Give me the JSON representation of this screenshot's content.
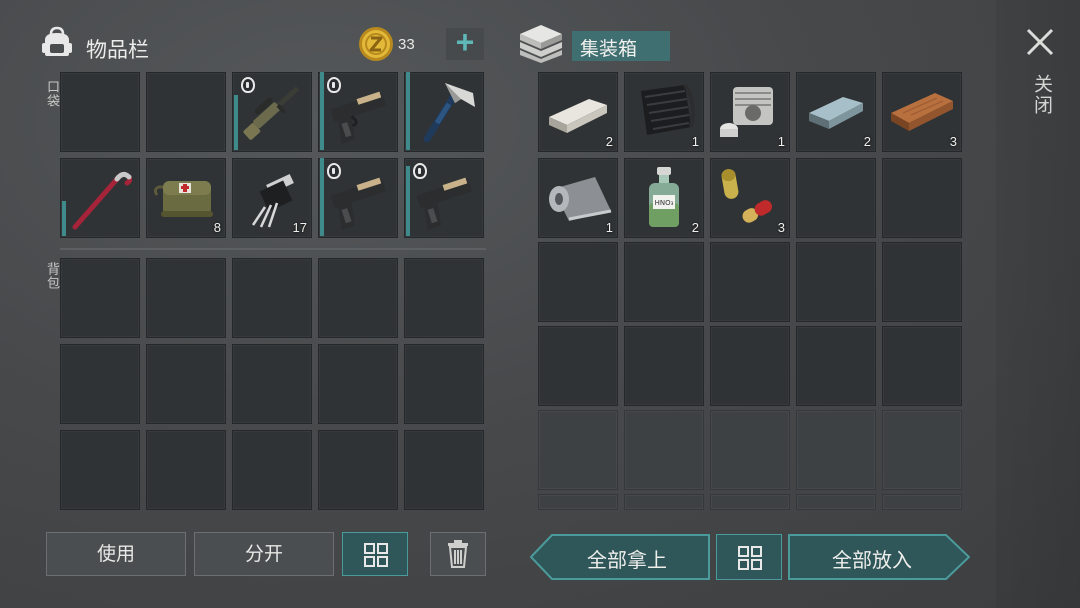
{
  "inventory": {
    "title": "物品栏",
    "coins": "33",
    "add_symbol": "+",
    "pocket_label": "口袋",
    "backpack_label": "背包",
    "items": [
      {
        "icon": "sniper-rifle-icon",
        "locked": true,
        "durability": 0.7
      },
      {
        "icon": "pistol-icon",
        "locked": true,
        "durability": 1.0
      },
      {
        "icon": "hatchet-icon",
        "locked": false,
        "durability": 1.0
      },
      {
        "icon": "crowbar-icon",
        "locked": false,
        "durability": 0.45
      },
      {
        "icon": "medkit-bag-icon",
        "count": "8"
      },
      {
        "icon": "transistor-icon",
        "count": "17"
      },
      {
        "icon": "pistol-icon",
        "locked": true,
        "durability": 1.0
      },
      {
        "icon": "pistol-icon",
        "locked": true,
        "durability": 0.9
      }
    ]
  },
  "container": {
    "title": "集装箱",
    "close_label": "关闭",
    "items": [
      {
        "icon": "stone-block-icon",
        "count": "2"
      },
      {
        "icon": "carbon-sheet-icon",
        "count": "1"
      },
      {
        "icon": "engine-cylinder-icon",
        "count": "1"
      },
      {
        "icon": "steel-ingot-icon",
        "count": "2"
      },
      {
        "icon": "wood-plank-icon",
        "count": "3"
      },
      {
        "icon": "metal-roll-icon",
        "count": "1"
      },
      {
        "icon": "chemical-bottle-icon",
        "count": "2",
        "bottle_label": "HNO₃"
      },
      {
        "icon": "capsules-icon",
        "count": "3"
      }
    ]
  },
  "buttons": {
    "use": "使用",
    "split": "分开",
    "take_all": "全部拿上",
    "put_all": "全部放入"
  },
  "colors": {
    "accent_teal": "#4c9b9c",
    "durability_bar": "#3f8a8b",
    "coin_gold": "#e3b93a"
  }
}
